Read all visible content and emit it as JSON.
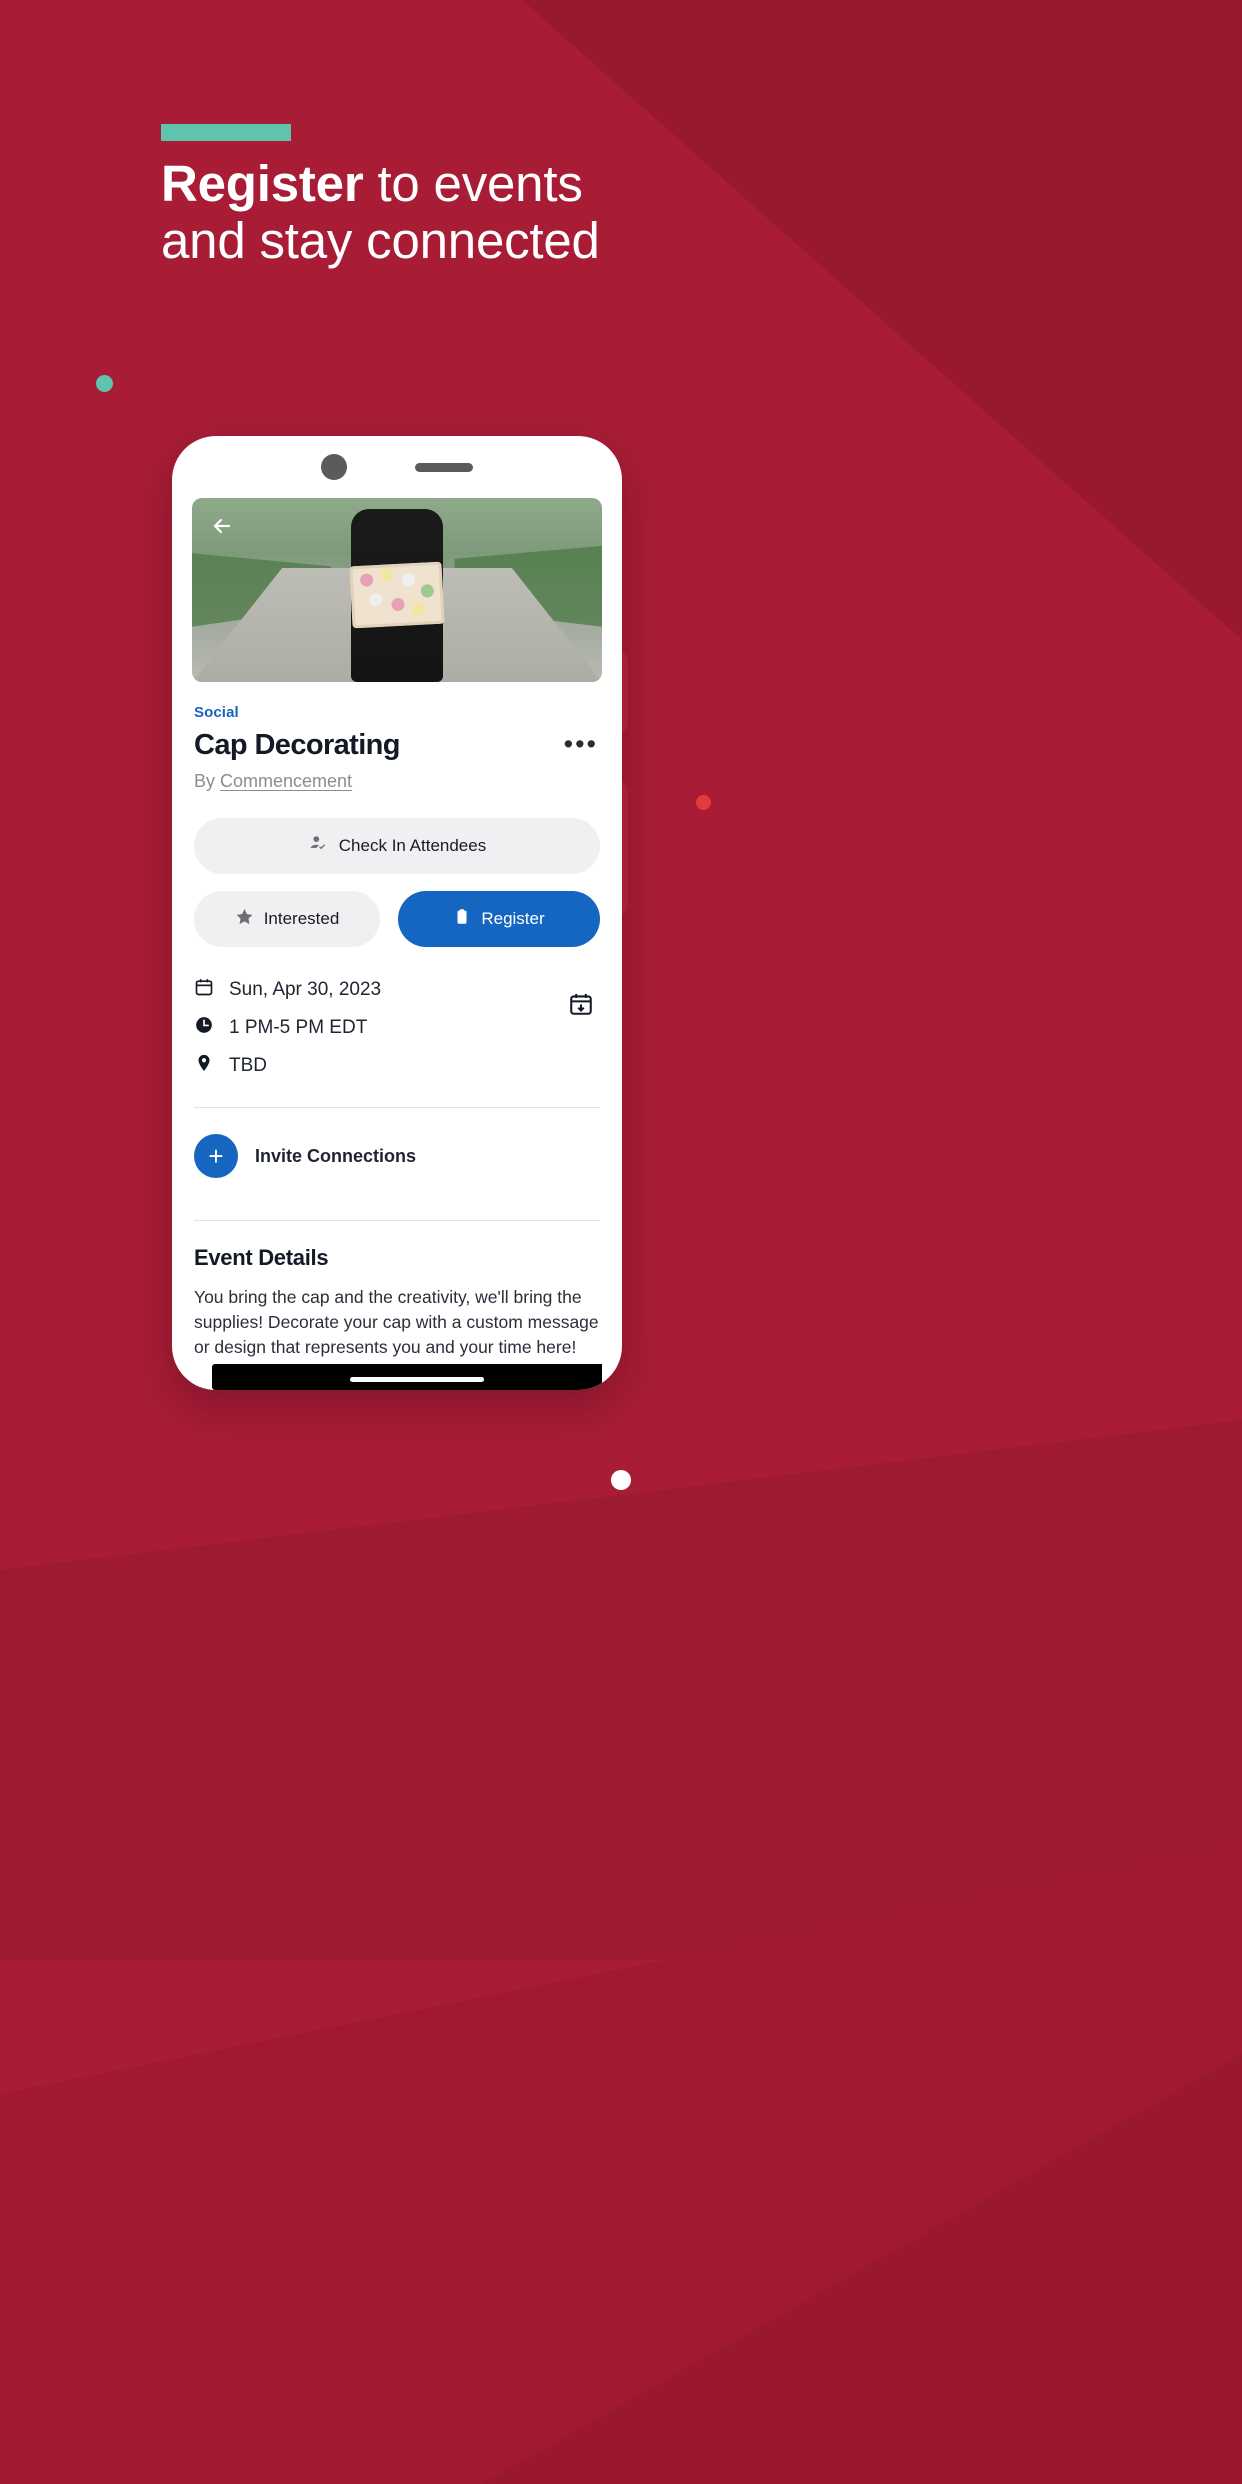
{
  "promo": {
    "accent_color": "#5FC3AE",
    "background_color": "#A81C36",
    "headline_bold": "Register",
    "headline_rest": " to events",
    "headline_line2": "and stay connected"
  },
  "phone": {
    "status_icons": {
      "camera": "camera-dot",
      "speaker": "speaker-grill"
    }
  },
  "screen": {
    "back_icon": "back-arrow-icon",
    "hero_image_alt": "graduate-holding-decorated-cap",
    "category": "Social",
    "title": "Cap Decorating",
    "overflow_menu": "•••",
    "byline_prefix": "By ",
    "byline_org": "Commencement",
    "buttons": {
      "check_in": "Check In Attendees",
      "check_in_icon": "person-check-icon",
      "interested": "Interested",
      "interested_icon": "star-icon",
      "register": "Register",
      "register_icon": "clipboard-icon",
      "register_color": "#1566C0"
    },
    "meta": [
      {
        "icon": "calendar-icon",
        "text": "Sun, Apr 30, 2023"
      },
      {
        "icon": "clock-icon",
        "text": "1 PM-5 PM EDT"
      },
      {
        "icon": "location-pin-icon",
        "text": "TBD"
      }
    ],
    "add_to_calendar_icon": "calendar-add-icon",
    "invite": {
      "icon": "plus-icon",
      "label": "Invite Connections"
    },
    "details": {
      "heading": "Event Details",
      "body": "You bring the cap and the creativity, we'll bring the supplies! Decorate your cap with a custom message or design that represents you and your time here!"
    }
  },
  "footer": {
    "page_indicator": "page-dot-active"
  }
}
